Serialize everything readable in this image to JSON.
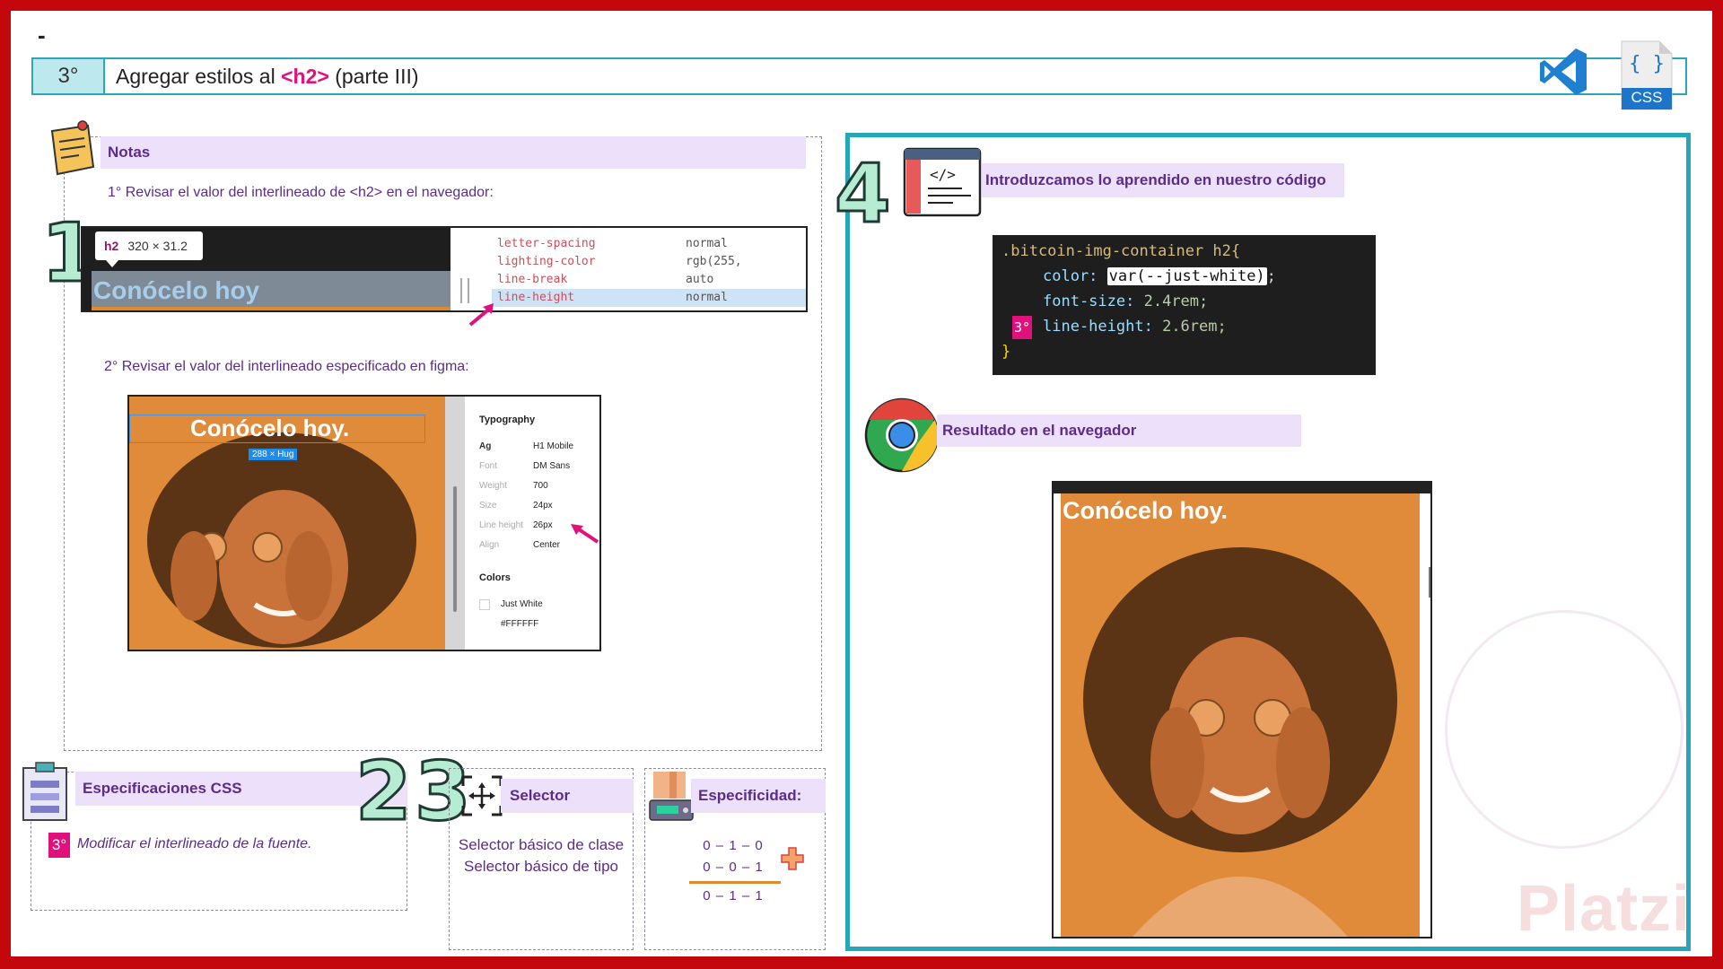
{
  "header": {
    "dash": "-",
    "step": "3°",
    "title_prefix": "Agregar estilos al",
    "title_tag": "<h2>",
    "title_suffix": "(parte III)",
    "css_label": "CSS"
  },
  "colors": {
    "frame": "#c4070d",
    "teal": "#26a6b6",
    "purple_text": "#5a2d8a",
    "band": "#ede0fb",
    "pink": "#e0117a",
    "orange": "#e08a2c"
  },
  "notes": {
    "title": "Notas",
    "step1_text": "1° Revisar el valor del interlineado de <h2> en el navegador:",
    "step2_text": "2° Revisar el valor del interlineado especificado en figma:",
    "numbers": {
      "one": "1",
      "two": "2",
      "three": "3",
      "four": "4"
    }
  },
  "devtools": {
    "tooltip_tag": "h2",
    "tooltip_size": "320 × 31.2",
    "heading": "Conócelo hoy",
    "rows": [
      {
        "name": "letter-spacing",
        "value": "normal"
      },
      {
        "name": "lighting-color",
        "value": "rgb(255,"
      },
      {
        "name": "line-break",
        "value": "auto"
      },
      {
        "name": "line-height",
        "value": "normal"
      }
    ]
  },
  "figma": {
    "heading": "Conócelo hoy.",
    "hug_label": "288 × Hug",
    "typography_title": "Typography",
    "rows": [
      {
        "label": "Ag",
        "value": "H1 Mobile"
      },
      {
        "label": "Font",
        "value": "DM Sans"
      },
      {
        "label": "Weight",
        "value": "700"
      },
      {
        "label": "Size",
        "value": "24px"
      },
      {
        "label": "Line height",
        "value": "26px"
      },
      {
        "label": "Align",
        "value": "Center"
      }
    ],
    "colors_title": "Colors",
    "color_name": "Just White",
    "color_hex": "#FFFFFF"
  },
  "specs": {
    "title": "Especificaciones CSS",
    "badge": "3°",
    "item": "Modificar el interlineado de la fuente."
  },
  "selector": {
    "title": "Selector",
    "lines": [
      "Selector básico de clase",
      "Selector básico de tipo"
    ]
  },
  "specificity": {
    "title": "Especificidad:",
    "rows": [
      "0 – 1 – 0",
      "0 – 0 – 1",
      "0 – 1 – 1"
    ]
  },
  "right": {
    "code_title": "Introduzcamos lo aprendido en nuestro código",
    "code": {
      "selector": ".bitcoin-img-container h2{",
      "p1": "color:",
      "v1": "var(--just-white)",
      "s1": ";",
      "p2": "font-size:",
      "v2": "2.4rem;",
      "badge": "3°",
      "p3": "line-height:",
      "v3": "2.6rem;",
      "close": "}"
    },
    "result_title": "Resultado en el navegador",
    "result_heading": "Conócelo hoy."
  },
  "watermark": "Platzi"
}
